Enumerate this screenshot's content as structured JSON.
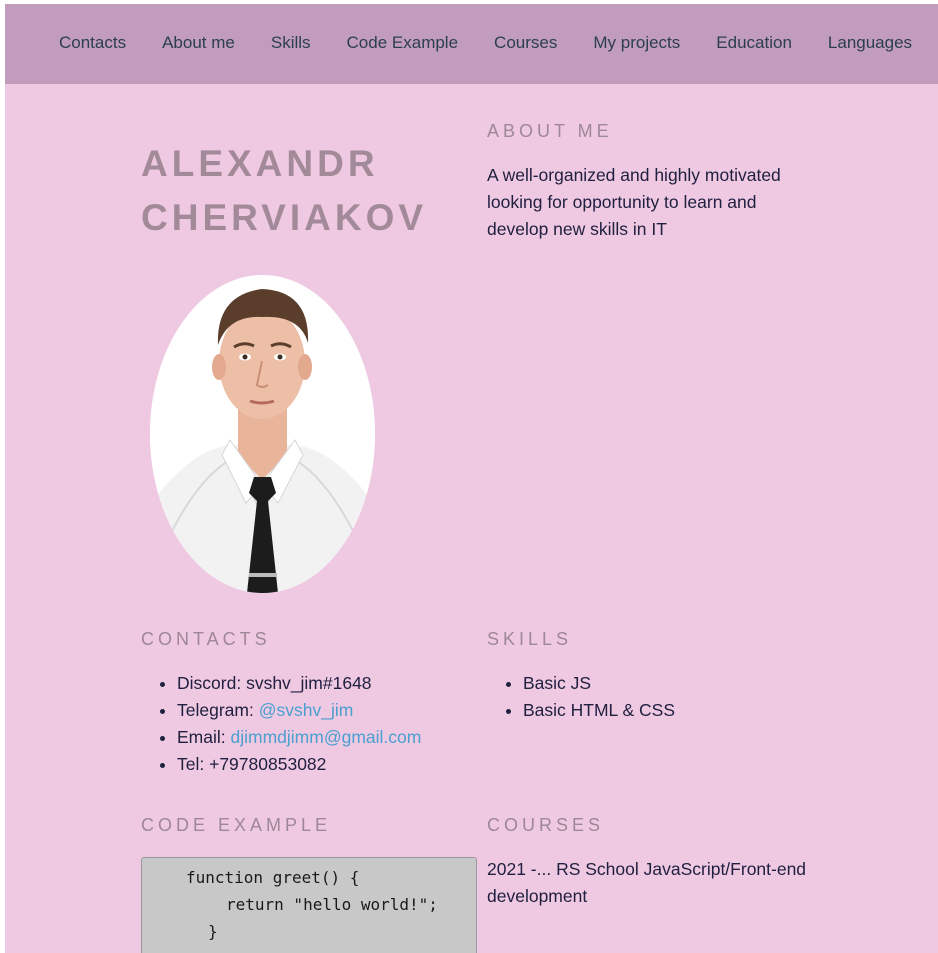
{
  "nav": {
    "items": [
      "Contacts",
      "About me",
      "Skills",
      "Code Example",
      "Courses",
      "My projects",
      "Education",
      "Languages"
    ]
  },
  "profile": {
    "name_line1": "ALEXANDR",
    "name_line2": "CHERVIAKOV"
  },
  "about": {
    "heading": "ABOUT ME",
    "text": "A well-organized and highly motivated looking for opportunity to learn and develop new skills in IT"
  },
  "contacts": {
    "heading": "CONTACTS",
    "discord_label": "Discord:",
    "discord_value": "svshv_jim#1648",
    "telegram_label": "Telegram:",
    "telegram_value": "@svshv_jim",
    "email_label": "Email:",
    "email_value": "djimmdjimm@gmail.com",
    "tel_label": "Tel:",
    "tel_value": "+79780853082"
  },
  "skills": {
    "heading": "SKILLS",
    "items": [
      "Basic JS",
      "Basic HTML & CSS"
    ]
  },
  "code": {
    "heading": "CODE EXAMPLE",
    "lines": [
      "function greet() {",
      "return \"hello world!\";",
      "}"
    ]
  },
  "courses": {
    "heading": "COURSES",
    "text": "2021 -... RS School JavaScript/Front-end development"
  },
  "colors": {
    "page_bg": "#efc9e2",
    "nav_bg": "#c19cbd",
    "heading": "#a38a98",
    "link": "#4a9fd0"
  }
}
